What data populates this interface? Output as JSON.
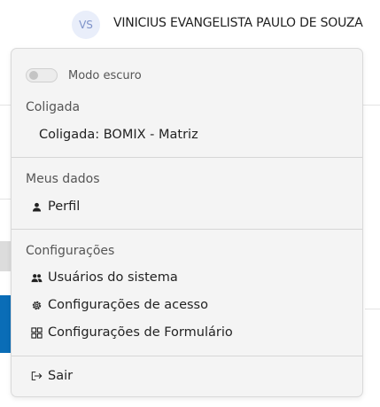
{
  "header": {
    "avatar_initials": "VS",
    "user_name": "VINICIUS EVANGELISTA PAULO DE SOUZA"
  },
  "menu": {
    "dark_mode": {
      "label": "Modo escuro",
      "enabled": false
    },
    "coligada": {
      "title": "Coligada",
      "value": "Coligada: BOMIX - Matriz"
    },
    "meus_dados": {
      "title": "Meus dados",
      "items": [
        {
          "label": "Perfil",
          "icon": "user-icon"
        }
      ]
    },
    "configuracoes": {
      "title": "Configurações",
      "items": [
        {
          "label": "Usuários do sistema",
          "icon": "users-icon"
        },
        {
          "label": "Configurações de acesso",
          "icon": "gear-icon"
        },
        {
          "label": "Configurações de Formulário",
          "icon": "form-grid-icon"
        }
      ]
    },
    "logout": {
      "label": "Sair",
      "icon": "logout-icon"
    }
  },
  "colors": {
    "accent_blue": "#0a6db7",
    "avatar_bg": "#e9eefa",
    "avatar_text": "#7f93c9"
  }
}
